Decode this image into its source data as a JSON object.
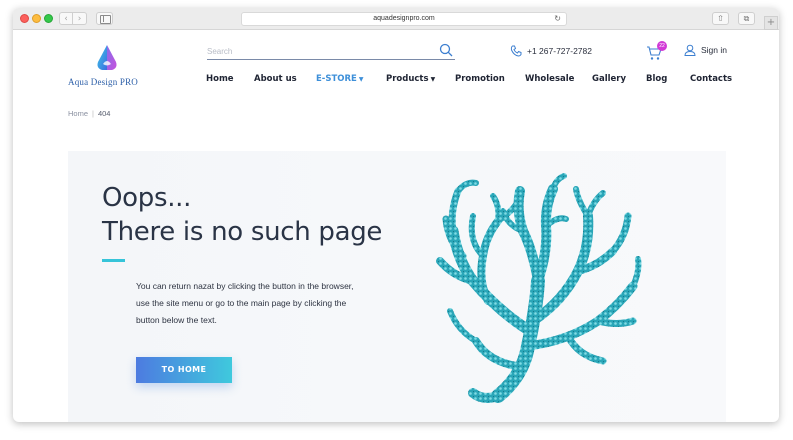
{
  "browser": {
    "url": "aquadesignpro.com",
    "icons": [
      "back-arrow-icon",
      "forward-arrow-icon",
      "sidebar-icon",
      "reload-icon",
      "share-icon",
      "tabs-icon",
      "plus-icon"
    ]
  },
  "header": {
    "logo_text": "Aqua Design PRO",
    "search_placeholder": "Search",
    "phone": "+1 267-727-2782",
    "cart_count": "22",
    "signin_label": "Sign in"
  },
  "nav": {
    "items": [
      {
        "label": "Home",
        "caret": ""
      },
      {
        "label": "About us",
        "caret": ""
      },
      {
        "label": "E-STORE",
        "caret": "▼"
      },
      {
        "label": "Products",
        "caret": "▼"
      },
      {
        "label": "Promotion",
        "caret": ""
      },
      {
        "label": "Wholesale",
        "caret": ""
      },
      {
        "label": "Gallery",
        "caret": ""
      },
      {
        "label": "Blog",
        "caret": ""
      },
      {
        "label": "Contacts",
        "caret": ""
      }
    ],
    "active_index": 2
  },
  "breadcrumb": {
    "home": "Home",
    "separator": "|",
    "current": "404"
  },
  "hero": {
    "title_line1": "Oops...",
    "title_line2": "There is no such page",
    "description": "You can return nazat by clicking the button in the browser, use the site menu or go to the main page by clicking the button below the text.",
    "button_label": "TO HOME"
  },
  "colors": {
    "accent": "#3d8fd9",
    "accent_line": "#36c4d9",
    "badge": "#d239d6",
    "coral": "#2aa6b8"
  }
}
